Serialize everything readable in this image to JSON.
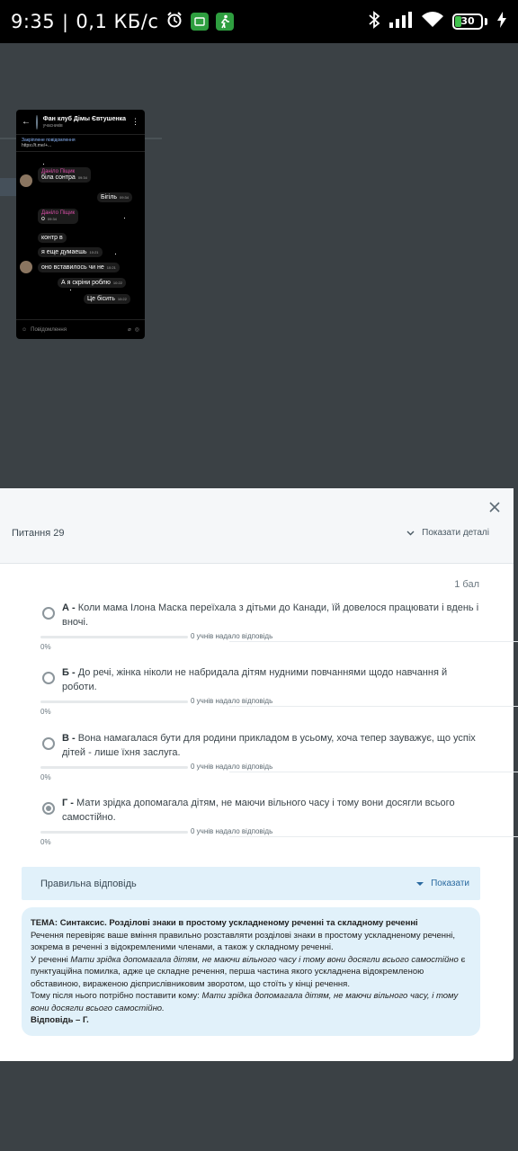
{
  "statusbar": {
    "time": "9:35",
    "net_speed": "0,1 КБ/с",
    "battery": "30",
    "battery_level": 0.3
  },
  "thumbnail": {
    "chat_title": "Фан клуб Дімы Євтушенка",
    "chat_sub": "учасників",
    "pinned_label": "Закріплене повідомлення",
    "pinned_link": "https://t.me/+...",
    "sender": "Даніло Піщик",
    "messages": {
      "m1_name": "Даніло Піщик",
      "m1_text": "біла сонтра",
      "m1_time": "09:34",
      "m2_text": "Бігiль",
      "m2_time": "09:34",
      "m3_name": "Даніло Піщик",
      "m3_text": "о",
      "m3_time": "09:34",
      "m4_text": "контр в",
      "m5_text": "я еще думаешь",
      "m5_time": "10:21",
      "m6_text": "оно вставилось чи не",
      "m6_time": "10:21",
      "m7_text": "А я скріни роблю",
      "m7_time": "10:22",
      "m8_text": "Це бісить",
      "m8_time": "10:22"
    },
    "input_placeholder": "Повідомлення"
  },
  "modal": {
    "question_title": "Питання 29",
    "details_label": "Показати деталі",
    "score": "1 бал",
    "options": [
      {
        "letter": "А -",
        "text": "Коли мама Ілона Маска переїхала з дітьми до Канади, їй довелося працювати і вдень і вночі.",
        "responses": "0 учнів надало відповідь",
        "percent": "0%",
        "share": 0
      },
      {
        "letter": "Б -",
        "text": "До речі, жінка ніколи не набридала дітям нудними повчаннями щодо навчання й роботи.",
        "responses": "0 учнів надало відповідь",
        "percent": "0%",
        "share": 0
      },
      {
        "letter": "В -",
        "text": "Вона намагалася бути для родини прикладом в усьому, хоча тепер зауважує, що успіх дітей - лише їхня заслуга.",
        "responses": "0 учнів надало відповідь",
        "percent": "0%",
        "share": 0
      },
      {
        "letter": "Г -",
        "text": "Мати зрідка допомагала дітям, не маючи вільного часу і тому вони досягли всього самостійно.",
        "responses": "0 учнів надало відповідь",
        "percent": "0%",
        "share": 0,
        "selected": true
      }
    ],
    "correct_answer_label": "Правильна відповідь",
    "show_label": "Показати",
    "explanation": {
      "topic": "ТЕМА: Синтаксис. Розділові знаки в простому ускладненому реченні та складному реченні",
      "p1": "Речення перевіряє ваше вміння правильно розставляти розділові знаки в простому ускладненому реченні, зокрема в реченні з відокремленими членами, а також у складному реченні.",
      "p2_a": "У реченні ",
      "p2_i": "Мати зрідка допомагала дітям, не маючи вільного часу і тому вони досягли всього самостійно",
      "p2_b": " є пунктуаційна помилка, адже це складне речення, перша частина якого ускладнена відокремленою обставиною, вираженою дієприслівниковим зворотом, що стоїть у кінці речення.",
      "p3_a": "Тому після нього потрібно поставити кому: ",
      "p3_i": "Мати зрідка допомагала дітям, не маючи вільного часу, і тому вони досягли всього самостійно.",
      "answer": "Відповідь – Г."
    }
  }
}
